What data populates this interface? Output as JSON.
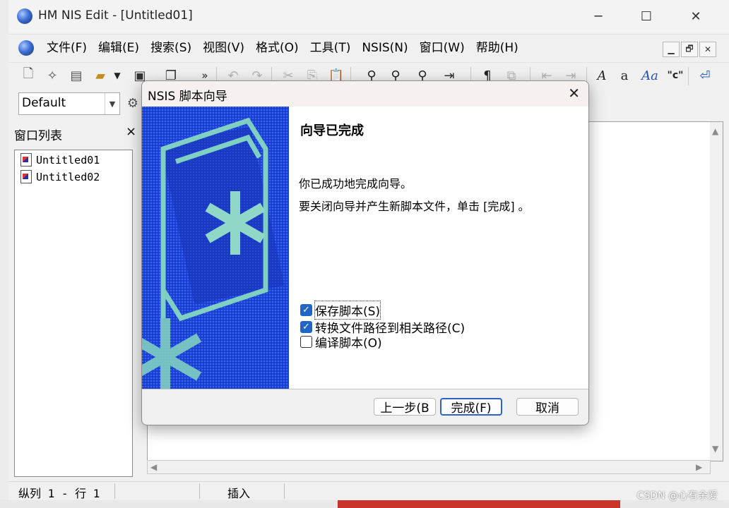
{
  "window": {
    "title": "HM NIS Edit - [Untitled01]",
    "controls": {
      "minimize": "─",
      "maximize": "☐",
      "close": "✕"
    }
  },
  "menu": {
    "items": [
      "文件(F)",
      "编辑(E)",
      "搜索(S)",
      "视图(V)",
      "格式(O)",
      "工具(T)",
      "NSIS(N)",
      "窗口(W)",
      "帮助(H)"
    ],
    "mdi_controls": [
      "▁",
      "🗗",
      "✕"
    ]
  },
  "toolbar": {
    "overflow_glyph": "»",
    "style_combo": "Default"
  },
  "panel": {
    "title": "窗口列表",
    "close": "×",
    "items": [
      "Untitled01",
      "Untitled02"
    ]
  },
  "status": {
    "position": "纵列 1 - 行 1",
    "mode": "插入"
  },
  "dialog": {
    "title": "NSIS 脚本向导",
    "close": "✕",
    "heading": "向导已完成",
    "line1": "你已成功地完成向导。",
    "line2": "要关闭向导并产生新脚本文件，单击 [完成] 。",
    "checkboxes": [
      {
        "label": "保存脚本(S)",
        "checked": true
      },
      {
        "label": "转换文件路径到相关路径(C)",
        "checked": true
      },
      {
        "label": "编译脚本(O)",
        "checked": false
      }
    ],
    "buttons": {
      "back": "上一步(B",
      "finish": "完成(F)",
      "cancel": "取消"
    },
    "art_colors": {
      "background": "#1c3fd6",
      "accent": "#7fcfc2"
    }
  },
  "watermark": "CSDN @心有余爱"
}
